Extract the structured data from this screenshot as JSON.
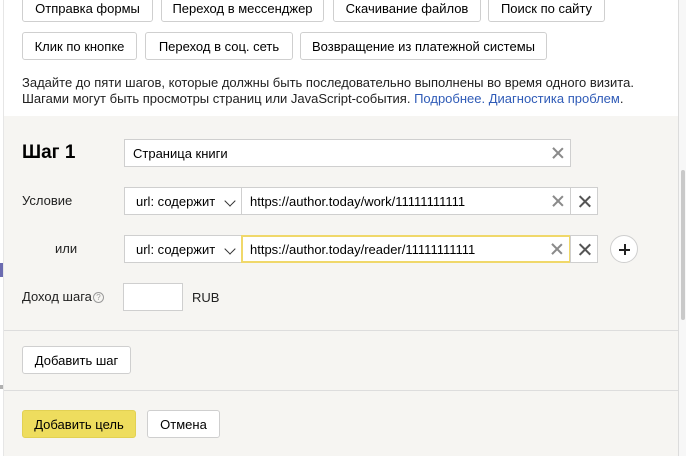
{
  "event_types": {
    "row1": [
      "Отправка формы",
      "Переход в мессенджер",
      "Скачивание файлов",
      "Поиск по сайту"
    ],
    "row2": [
      "Клик по кнопке",
      "Переход в соц. сеть",
      "Возвращение из платежной системы"
    ]
  },
  "info": {
    "text_line1": "Задайте до пяти шагов, которые должны быть последовательно выполнены во время одного визита.",
    "text_line2": "Шагами могут быть просмотры страниц или JavaScript-события.",
    "link_more": "Подробнее.",
    "link_diag": "Диагностика проблем",
    "period": "."
  },
  "step": {
    "title": "Шаг 1",
    "name_value": "Страница книги",
    "condition_label": "Условие",
    "or_label": "или",
    "conditions": [
      {
        "type": "url: содержит",
        "value": "https://author.today/work/11111111111"
      },
      {
        "type": "url: содержит",
        "value": "https://author.today/reader/11111111111"
      }
    ],
    "revenue_label": "Доход шага",
    "revenue_help": "?",
    "revenue_value": "",
    "currency": "RUB"
  },
  "actions": {
    "add_step": "Добавить шаг",
    "add_goal": "Добавить цель",
    "cancel": "Отмена"
  },
  "colors": {
    "primary_button": "#eedd5e",
    "link": "#2f5bb7",
    "focus_border": "#f0d86a",
    "panel_bg": "#f6f5f2"
  }
}
